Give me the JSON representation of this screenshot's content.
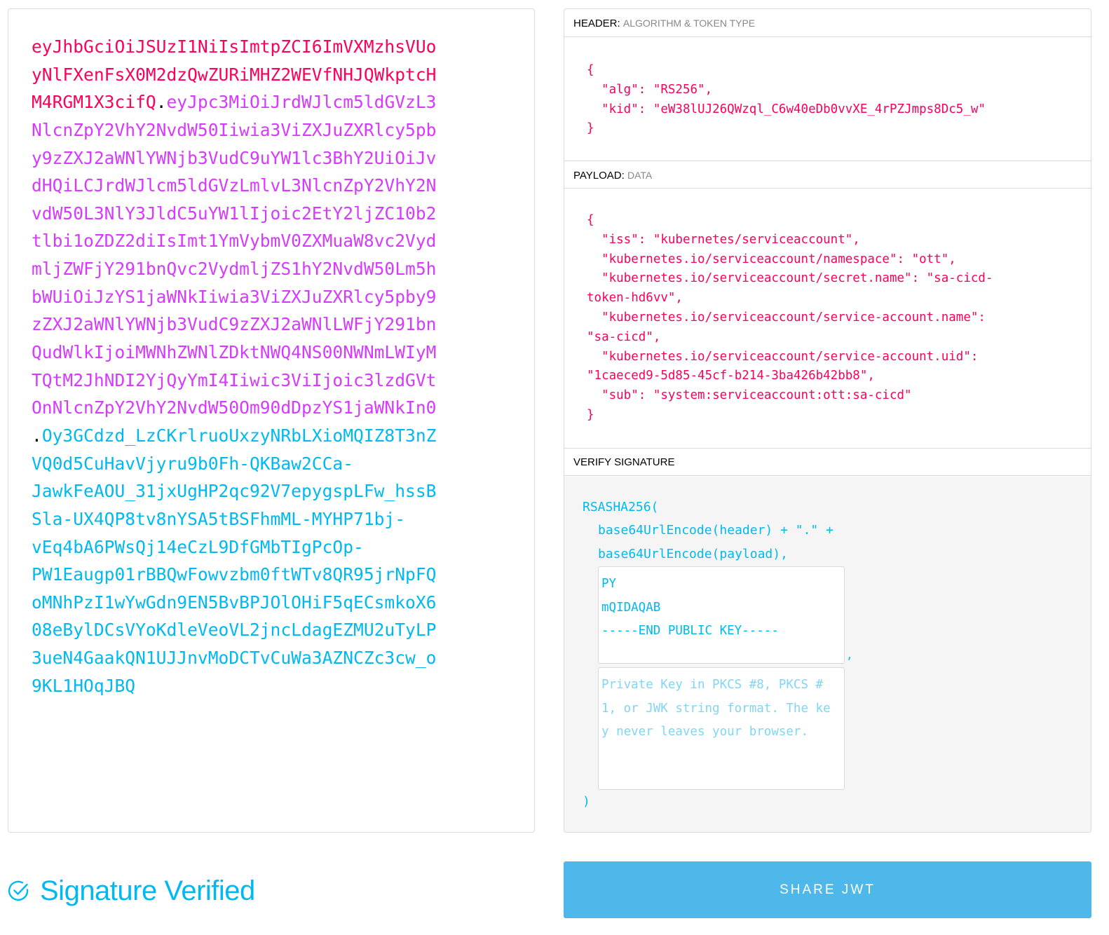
{
  "encoded": {
    "lines": [
      [
        {
          "t": "eyJhbGciOiJSUzI1NiIsImtpZCI6ImVXMzhsVUo",
          "c": "header"
        }
      ],
      [
        {
          "t": "yNlFXenFsX0M2dzQwZURiMHZ2WEVfNHJQWkptcH",
          "c": "header"
        }
      ],
      [
        {
          "t": "M4RGM1X3cifQ",
          "c": "header"
        },
        {
          "t": ".",
          "c": "dot"
        },
        {
          "t": "eyJpc3MiOiJrdWJlcm5ldGVzL3",
          "c": "payload"
        }
      ],
      [
        {
          "t": "NlcnZpY2VhY2NvdW50Iiwia3ViZXJuZXRlcy5pb",
          "c": "payload"
        }
      ],
      [
        {
          "t": "y9zZXJ2aWNlYWNjb3VudC9uYW1lc3BhY2UiOiJv",
          "c": "payload"
        }
      ],
      [
        {
          "t": "dHQiLCJrdWJlcm5ldGVzLmlvL3NlcnZpY2VhY2N",
          "c": "payload"
        }
      ],
      [
        {
          "t": "vdW50L3NlY3JldC5uYW1lIjoic2EtY2ljZC10b2",
          "c": "payload"
        }
      ],
      [
        {
          "t": "tlbi1oZDZ2diIsImt1YmVybmV0ZXMuaW8vc2Vyd",
          "c": "payload"
        }
      ],
      [
        {
          "t": "mljZWFjY291bnQvc2VydmljZS1hY2NvdW50Lm5h",
          "c": "payload"
        }
      ],
      [
        {
          "t": "bWUiOiJzYS1jaWNkIiwia3ViZXJuZXRlcy5pby9",
          "c": "payload"
        }
      ],
      [
        {
          "t": "zZXJ2aWNlYWNjb3VudC9zZXJ2aWNlLWFjY291bn",
          "c": "payload"
        }
      ],
      [
        {
          "t": "QudWlkIjoiMWNhZWNlZDktNWQ4NS00NWNmLWIyM",
          "c": "payload"
        }
      ],
      [
        {
          "t": "TQtM2JhNDI2YjQyYmI4Iiwic3ViIjoic3lzdGVt",
          "c": "payload"
        }
      ],
      [
        {
          "t": "OnNlcnZpY2VhY2NvdW50Om90dDpzYS1jaWNkIn0",
          "c": "payload"
        }
      ],
      [
        {
          "t": ".",
          "c": "dot"
        },
        {
          "t": "Oy3GCdzd_LzCKrlruoUxzyNRbLXioMQIZ8T3nZ",
          "c": "sig"
        }
      ],
      [
        {
          "t": "VQ0d5CuHavVjyru9b0Fh-QKBaw2CCa-",
          "c": "sig"
        }
      ],
      [
        {
          "t": "JawkFeAOU_31jxUgHP2qc92V7epygspLFw_hssB",
          "c": "sig"
        }
      ],
      [
        {
          "t": "Sla-UX4QP8tv8nYSA5tBSFhmML-MYHP71bj-",
          "c": "sig"
        }
      ],
      [
        {
          "t": "vEq4bA6PWsQj14eCzL9DfGMbTIgPcOp-",
          "c": "sig"
        }
      ],
      [
        {
          "t": "PW1Eaugp01rBBQwFowvzbm0ftWTv8QR95jrNpFQ",
          "c": "sig"
        }
      ],
      [
        {
          "t": "oMNhPzI1wYwGdn9EN5BvBPJOlOHiF5qECsmkoX6",
          "c": "sig"
        }
      ],
      [
        {
          "t": "08eBylDCsVYoKdleVeoVL2jncLdagEZMU2uTyLP",
          "c": "sig"
        }
      ],
      [
        {
          "t": "3ueN4GaakQN1UJJnvMoDCTvCuWa3AZNCZc3cw_o",
          "c": "sig"
        }
      ],
      [
        {
          "t": "9KL1HOqJBQ",
          "c": "sig"
        }
      ]
    ]
  },
  "header_section": {
    "title": "HEADER:",
    "subtitle": "ALGORITHM & TOKEN TYPE",
    "json_lines": [
      "{",
      "  \"alg\": \"RS256\",",
      "  \"kid\": \"eW38lUJ26QWzql_C6w40eDb0vvXE_4rPZJmps8Dc5_w\"",
      "}"
    ]
  },
  "payload_section": {
    "title": "PAYLOAD:",
    "subtitle": "DATA",
    "json_lines": [
      "{",
      "  \"iss\": \"kubernetes/serviceaccount\",",
      "  \"kubernetes.io/serviceaccount/namespace\": \"ott\",",
      "  \"kubernetes.io/serviceaccount/secret.name\": \"sa-cicd-",
      "token-hd6vv\",",
      "  \"kubernetes.io/serviceaccount/service-account.name\":",
      "\"sa-cicd\",",
      "  \"kubernetes.io/serviceaccount/service-account.uid\":",
      "\"1caeced9-5d85-45cf-b214-3ba426b42bb8\",",
      "  \"sub\": \"system:serviceaccount:ott:sa-cicd\"",
      "}"
    ]
  },
  "verify_section": {
    "title": "VERIFY SIGNATURE",
    "fn_open": "RSASHA256(",
    "line_header": "base64UrlEncode(header) + \".\" +",
    "line_payload": "base64UrlEncode(payload),",
    "public_key_lines": [
      "PY",
      "mQIDAQAB",
      "-----END PUBLIC KEY-----"
    ],
    "comma": ",",
    "private_key_placeholder_lines": [
      "Private Key in PKCS #8, PKCS #",
      "1, or JWK string format. The ke",
      "y never leaves your browser."
    ],
    "fn_close": ")"
  },
  "status": {
    "icon": "check-circle-icon",
    "text": "Signature Verified"
  },
  "share_button": {
    "label": "SHARE JWT"
  },
  "colors": {
    "header": "#fb015b",
    "payload": "#d63aff",
    "signature": "#00b9f1",
    "button": "#4fb8ea"
  }
}
